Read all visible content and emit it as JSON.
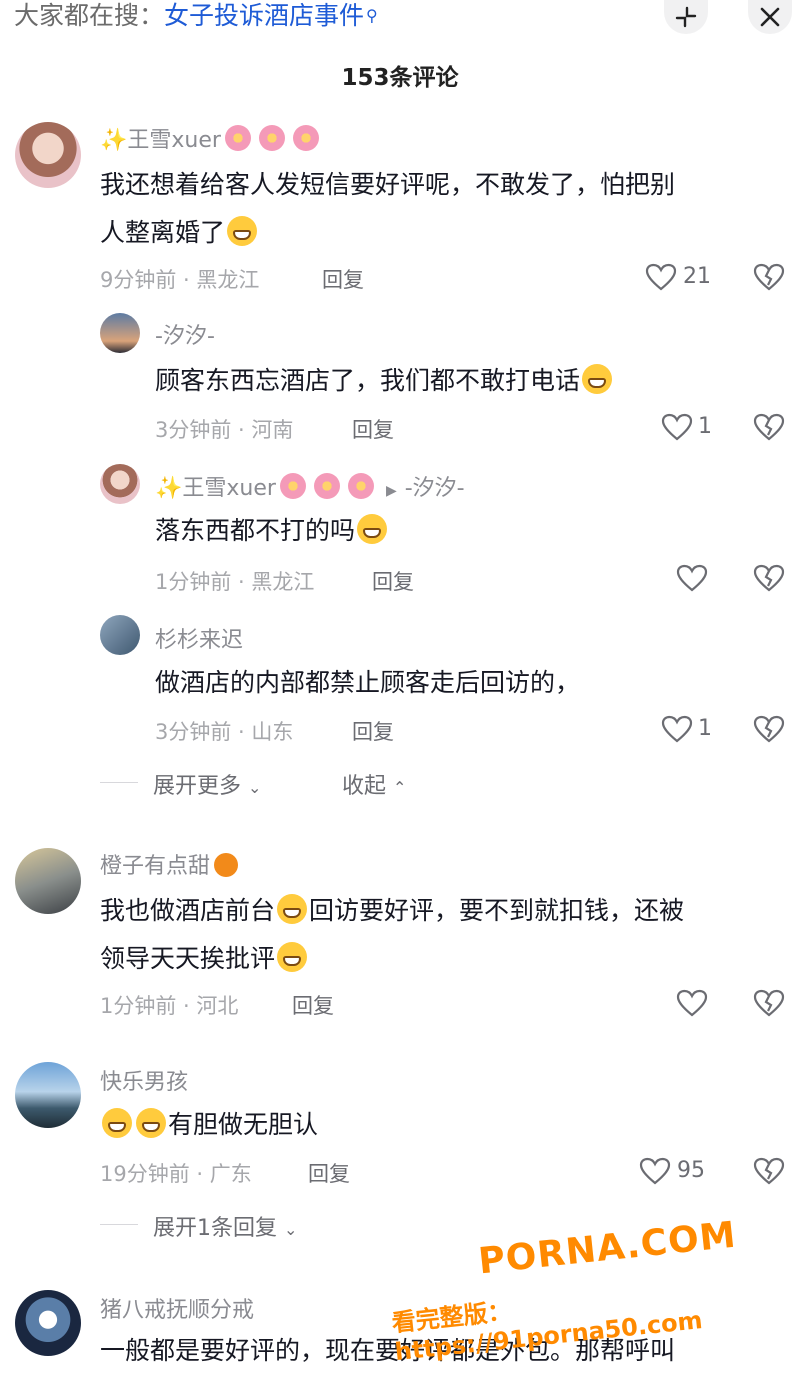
{
  "search": {
    "prefix": "大家都在搜：",
    "term": "女子投诉酒店事件",
    "icon": "search-icon"
  },
  "header": {
    "count_title": "153条评论",
    "collapse_icon": "collapse-icon",
    "close_icon": "close-icon"
  },
  "comments": [
    {
      "user": "✨王雪xuer",
      "line1": "我还想着给客人发短信要好评呢，不敢发了，怕把别",
      "line2": "人整离婚了",
      "meta": "9分钟前 · 黑龙江",
      "reply": "回复",
      "likes": "21"
    },
    {
      "user": "-汐汐-",
      "line1": "顾客东西忘酒店了，我们都不敢打电话",
      "meta": "3分钟前 · 河南",
      "reply": "回复",
      "likes": "1"
    },
    {
      "user": "✨王雪xuer",
      "reply_to": "-汐汐-",
      "line1": "落东西都不打的吗",
      "meta": "1分钟前 · 黑龙江",
      "reply": "回复",
      "likes": ""
    },
    {
      "user": "杉杉来迟",
      "line1": "做酒店的内部都禁止顾客走后回访的，",
      "meta": "3分钟前 · 山东",
      "reply": "回复",
      "likes": "1"
    },
    {
      "user": "橙子有点甜",
      "line1a": "我也做酒店前台",
      "line1b": "回访要好评，要不到就扣钱，还被",
      "line2": "领导天天挨批评",
      "meta": "1分钟前 · 河北",
      "reply": "回复",
      "likes": ""
    },
    {
      "user": "快乐男孩",
      "line1": "有胆做无胆认",
      "meta": "19分钟前 · 广东",
      "reply": "回复",
      "likes": "95"
    },
    {
      "user": "猪八戒抚顺分戒",
      "line1": "一般都是要好评的，现在要好评都是外包。那帮呼叫"
    }
  ],
  "expand": {
    "more": "展开更多",
    "collapse": "收起",
    "one_reply": "展开1条回复"
  },
  "watermark": {
    "brand": "PORNA.COM",
    "label": "看完整版：https://91porna50.com"
  },
  "colors": {
    "link": "#1e5bd6",
    "muted": "#a6a7ab",
    "text": "#161823",
    "watermark": "#ff8a00"
  }
}
